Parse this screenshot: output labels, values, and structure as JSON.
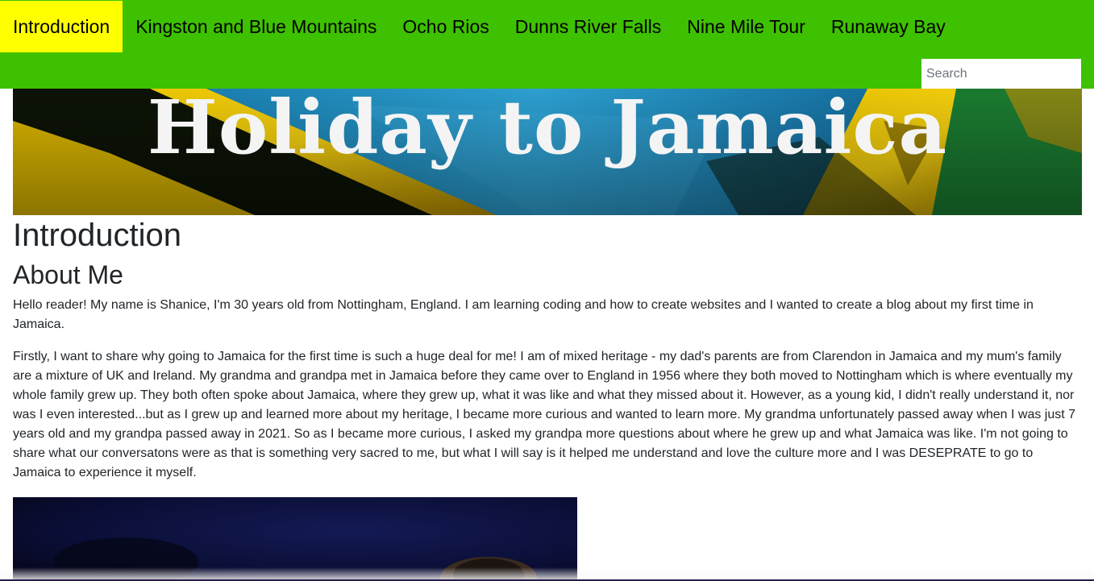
{
  "nav": {
    "items": [
      {
        "label": "Introduction",
        "active": true
      },
      {
        "label": "Kingston and Blue Mountains",
        "active": false
      },
      {
        "label": "Ocho Rios",
        "active": false
      },
      {
        "label": "Dunns River Falls",
        "active": false
      },
      {
        "label": "Nine Mile Tour",
        "active": false
      },
      {
        "label": "Runaway Bay",
        "active": false
      }
    ],
    "search_placeholder": "Search"
  },
  "hero": {
    "title": "Holiday to Jamaica"
  },
  "main": {
    "page_title": "Introduction",
    "section_title": "About Me",
    "paragraphs": [
      "Hello reader! My name is Shanice, I'm 30 years old from Nottingham, England. I am learning coding and how to create websites and I wanted to create a blog about my first time in Jamaica.",
      "Firstly, I want to share why going to Jamaica for the first time is such a huge deal for me! I am of mixed heritage - my dad's parents are from Clarendon in Jamaica and my mum's family are a mixture of UK and Ireland. My grandma and grandpa met in Jamaica before they came over to England in 1956 where they both moved to Nottingham which is where eventually my whole family grew up. They both often spoke about Jamaica, where they grew up, what it was like and what they missed about it. However, as a young kid, I didn't really understand it, nor was I even interested...but as I grew up and learned more about my heritage, I became more curious and wanted to learn more. My grandma unfortunately passed away when I was just 7 years old and my grandpa passed away in 2021. So as I became more curious, I asked my grandpa more questions about where he grew up and what Jamaica was like. I'm not going to share what our conversatons were as that is something very sacred to me, but what I will say is it helped me understand and love the culture more and I was DESEPRATE to go to Jamaica to experience it myself."
    ]
  },
  "colors": {
    "navbar_bg": "#3ec100",
    "active_item_bg": "#ffff00",
    "flag_green": "#1e9b5a",
    "flag_gold": "#f5c400",
    "flag_black": "#000000"
  }
}
